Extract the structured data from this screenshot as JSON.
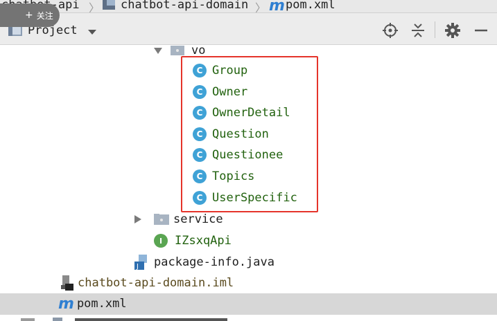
{
  "breadcrumb": {
    "items": [
      {
        "label": "chatbot-api"
      },
      {
        "label": "chatbot-api-domain"
      },
      {
        "label": "pom.xml"
      }
    ],
    "m_glyph": "m"
  },
  "follow_badge": {
    "plus": "+",
    "label": "关注"
  },
  "toolbar": {
    "title": "Project",
    "icons": [
      "folder-icon",
      "chevron-down-icon",
      "locate-target-icon",
      "collapse-all-icon",
      "gear-icon",
      "minimize-icon"
    ]
  },
  "tree": {
    "vo_folder": "vo",
    "classes": [
      {
        "glyph": "C",
        "label": "Group"
      },
      {
        "glyph": "C",
        "label": "Owner"
      },
      {
        "glyph": "C",
        "label": "OwnerDetail"
      },
      {
        "glyph": "C",
        "label": "Question"
      },
      {
        "glyph": "C",
        "label": "Questionee"
      },
      {
        "glyph": "C",
        "label": "Topics"
      },
      {
        "glyph": "C",
        "label": "UserSpecific"
      }
    ],
    "service_folder": "service",
    "interface": {
      "glyph": "I",
      "label": "IZsxqApi"
    },
    "package_info": "package-info.java",
    "iml_file": "chatbot-api-domain.iml",
    "pom_file": {
      "glyph": "m",
      "label": "pom.xml"
    }
  },
  "colors": {
    "class_icon": "#3fa2d6",
    "interface_icon": "#5aa552",
    "class_text": "#22620f",
    "highlight_box": "#e5332a",
    "selection": "#d7d7d7"
  }
}
